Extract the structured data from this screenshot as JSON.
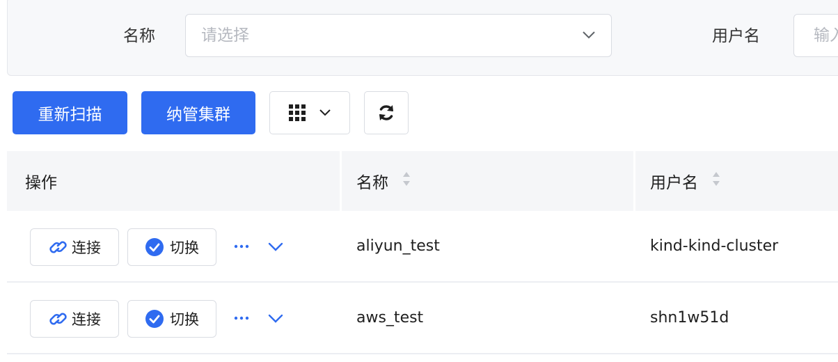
{
  "filters": {
    "name_label": "名称",
    "name_placeholder": "请选择",
    "username_label": "用户名",
    "username_placeholder": "输入"
  },
  "toolbar": {
    "rescan_label": "重新扫描",
    "manage_cluster_label": "纳管集群",
    "columns_icon": "grid-icon",
    "refresh_icon": "refresh-icon"
  },
  "table": {
    "columns": [
      "操作",
      "名称",
      "用户名"
    ],
    "actions": {
      "connect_label": "连接",
      "switch_label": "切换"
    },
    "rows": [
      {
        "name": "aliyun_test",
        "username": "kind-kind-cluster"
      },
      {
        "name": "aws_test",
        "username": "shn1w51d"
      }
    ]
  },
  "colors": {
    "primary": "#2f6bf0",
    "header_bg": "#f5f6f8",
    "filter_bg": "#f7f8fa"
  }
}
